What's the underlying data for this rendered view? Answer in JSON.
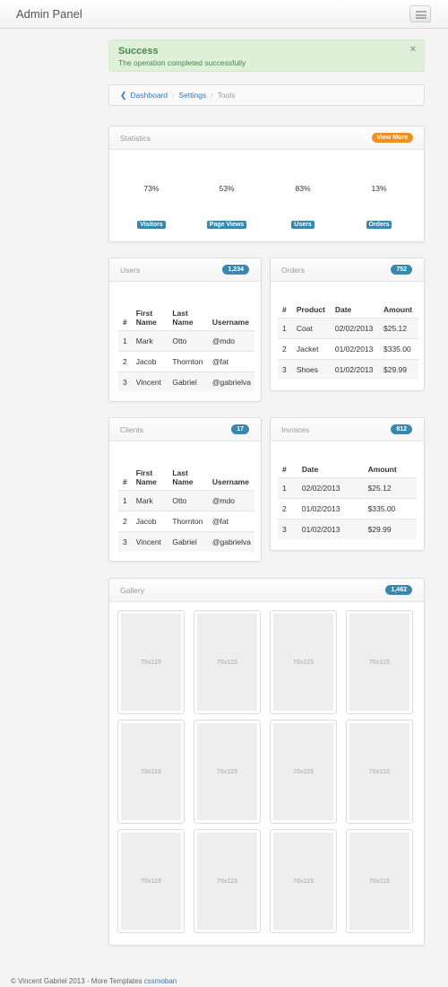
{
  "navbar": {
    "brand": "Admin Panel",
    "menu_icon": "hamburger-icon"
  },
  "alert": {
    "title": "Success",
    "message": "The operation completed successfully",
    "close": "×"
  },
  "breadcrumb": {
    "back_icon": "❮",
    "items": [
      "Dashboard",
      "Settings",
      "Tools"
    ]
  },
  "statistics": {
    "title": "Statistics",
    "button": "View More",
    "items": [
      {
        "value": "73%",
        "label": "Visitors"
      },
      {
        "value": "53%",
        "label": "Page Views"
      },
      {
        "value": "83%",
        "label": "Users"
      },
      {
        "value": "13%",
        "label": "Orders"
      }
    ]
  },
  "users": {
    "title": "Users",
    "badge": "1,234",
    "headers": [
      "#",
      "First Name",
      "Last Name",
      "Username"
    ],
    "rows": [
      [
        "1",
        "Mark",
        "Otto",
        "@mdo"
      ],
      [
        "2",
        "Jacob",
        "Thornton",
        "@fat"
      ],
      [
        "3",
        "Vincent",
        "Gabriel",
        "@gabrielva"
      ]
    ]
  },
  "orders": {
    "title": "Orders",
    "badge": "752",
    "headers": [
      "#",
      "Product",
      "Date",
      "Amount"
    ],
    "rows": [
      [
        "1",
        "Coat",
        "02/02/2013",
        "$25.12"
      ],
      [
        "2",
        "Jacket",
        "01/02/2013",
        "$335.00"
      ],
      [
        "3",
        "Shoes",
        "01/02/2013",
        "$29.99"
      ]
    ]
  },
  "clients": {
    "title": "Clients",
    "badge": "17",
    "headers": [
      "#",
      "First Name",
      "Last Name",
      "Username"
    ],
    "rows": [
      [
        "1",
        "Mark",
        "Otto",
        "@mdo"
      ],
      [
        "2",
        "Jacob",
        "Thornton",
        "@fat"
      ],
      [
        "3",
        "Vincent",
        "Gabriel",
        "@gabrielva"
      ]
    ]
  },
  "invoices": {
    "title": "Invoices",
    "badge": "812",
    "headers": [
      "#",
      "Date",
      "Amount"
    ],
    "rows": [
      [
        "1",
        "02/02/2013",
        "$25.12"
      ],
      [
        "2",
        "01/02/2013",
        "$335.00"
      ],
      [
        "3",
        "01/02/2013",
        "$29.99"
      ]
    ]
  },
  "gallery": {
    "title": "Gallery",
    "badge": "1,462",
    "placeholders": [
      "70x115",
      "70x115",
      "70x115",
      "70x115",
      "70x115",
      "70x115",
      "70x115",
      "70x115",
      "70x115",
      "70x115",
      "70x115",
      "70x115"
    ]
  },
  "footer": {
    "text": "© Vincent Gabriel 2013 - More Templates",
    "link": "cssmoban"
  }
}
